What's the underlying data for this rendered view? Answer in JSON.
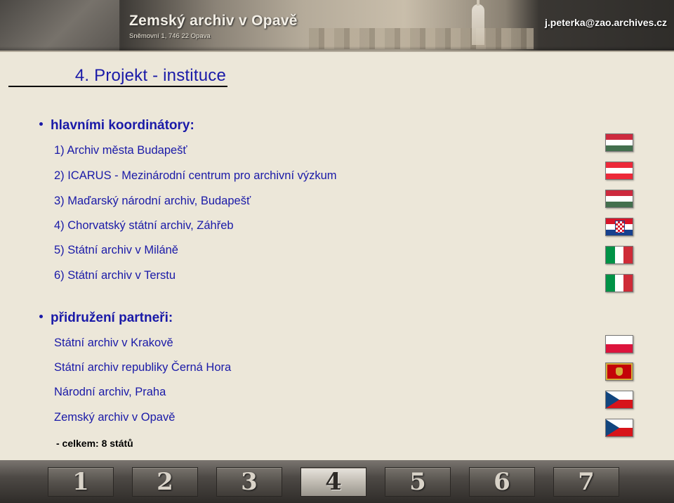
{
  "header": {
    "title": "Zemský archiv v Opavě",
    "subtitle": "Sněmovní 1, 746 22 Opava",
    "email": "j.peterka@zao.archives.cz"
  },
  "slide": {
    "title": "4. Projekt - instituce",
    "coordinators_heading": "hlavními koordinátory:",
    "coordinators": [
      "1) Archiv města Budapešť",
      "2) ICARUS - Mezinárodní centrum pro archivní výzkum",
      "3) Maďarský národní archiv, Budapešť",
      "4) Chorvatský státní archiv, Záhřeb",
      "5) Státní archiv v Miláně",
      "6) Státní archiv v Terstu"
    ],
    "partners_heading": "přidružení partneři:",
    "partners": [
      "Státní archiv v Krakově",
      "Státní archiv republiky Černá Hora",
      "Národní archiv, Praha",
      "Zemský archiv v Opavě"
    ],
    "total": "- celkem: 8 států"
  },
  "flags": [
    {
      "country": "hungary",
      "icon": "hungary-flag-icon"
    },
    {
      "country": "austria",
      "icon": "austria-flag-icon"
    },
    {
      "country": "hungary",
      "icon": "hungary-flag-icon"
    },
    {
      "country": "croatia",
      "icon": "croatia-flag-icon"
    },
    {
      "country": "italy",
      "icon": "italy-flag-icon"
    },
    {
      "country": "italy",
      "icon": "italy-flag-icon"
    },
    {
      "country": "poland",
      "icon": "poland-flag-icon"
    },
    {
      "country": "montenegro",
      "icon": "montenegro-flag-icon"
    },
    {
      "country": "czech-republic",
      "icon": "czech-flag-icon"
    },
    {
      "country": "czech-republic",
      "icon": "czech-flag-icon"
    }
  ],
  "nav": {
    "buttons": [
      "1",
      "2",
      "3",
      "4",
      "5",
      "6",
      "7"
    ],
    "active": "4"
  },
  "colors": {
    "text_blue": "#1a1aa8",
    "background": "#ece7d9"
  }
}
